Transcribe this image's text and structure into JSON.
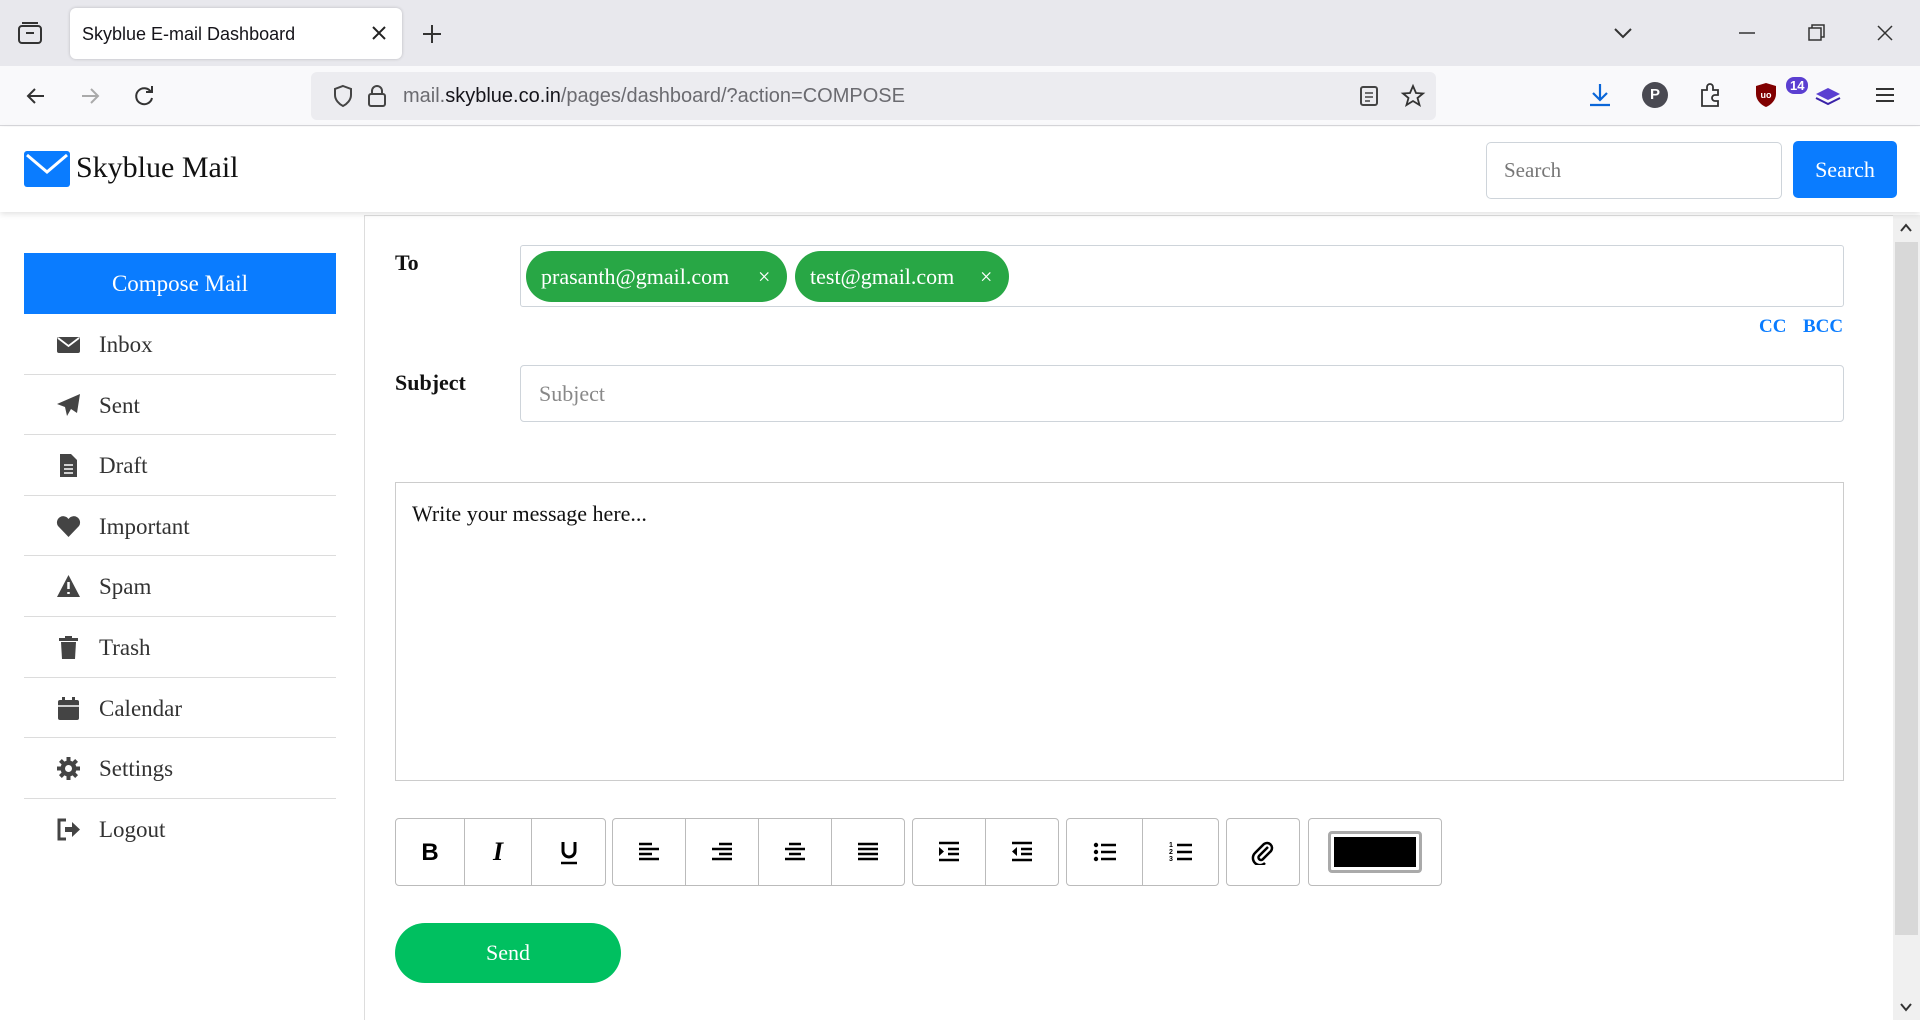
{
  "browser": {
    "tab_title": "Skyblue E-mail Dashboard",
    "url_prefix": "mail.",
    "url_host": "skyblue.co.in",
    "url_path": "/pages/dashboard/?action=COMPOSE",
    "extension_badge": "14",
    "profile_initial": "P"
  },
  "header": {
    "brand_name": "Skyblue Mail",
    "search_placeholder": "Search",
    "search_button": "Search"
  },
  "sidebar": {
    "compose_label": "Compose Mail",
    "items": [
      {
        "label": "Inbox",
        "icon": "envelope-icon"
      },
      {
        "label": "Sent",
        "icon": "paper-plane-icon"
      },
      {
        "label": "Draft",
        "icon": "file-icon"
      },
      {
        "label": "Important",
        "icon": "heart-icon"
      },
      {
        "label": "Spam",
        "icon": "warning-icon"
      },
      {
        "label": "Trash",
        "icon": "trash-icon"
      },
      {
        "label": "Calendar",
        "icon": "calendar-icon"
      },
      {
        "label": "Settings",
        "icon": "gear-icon"
      },
      {
        "label": "Logout",
        "icon": "logout-icon"
      }
    ]
  },
  "compose": {
    "to_label": "To",
    "recipients": [
      "prasanth@gmail.com",
      "test@gmail.com"
    ],
    "remove_symbol": "×",
    "cc_label": "CC",
    "bcc_label": "BCC",
    "subject_label": "Subject",
    "subject_placeholder": "Subject",
    "message_placeholder": "Write your message here...",
    "send_label": "Send",
    "text_color": "#000000"
  },
  "colors": {
    "primary": "#0a7cff",
    "chip": "#28a745",
    "send": "#00c060"
  }
}
